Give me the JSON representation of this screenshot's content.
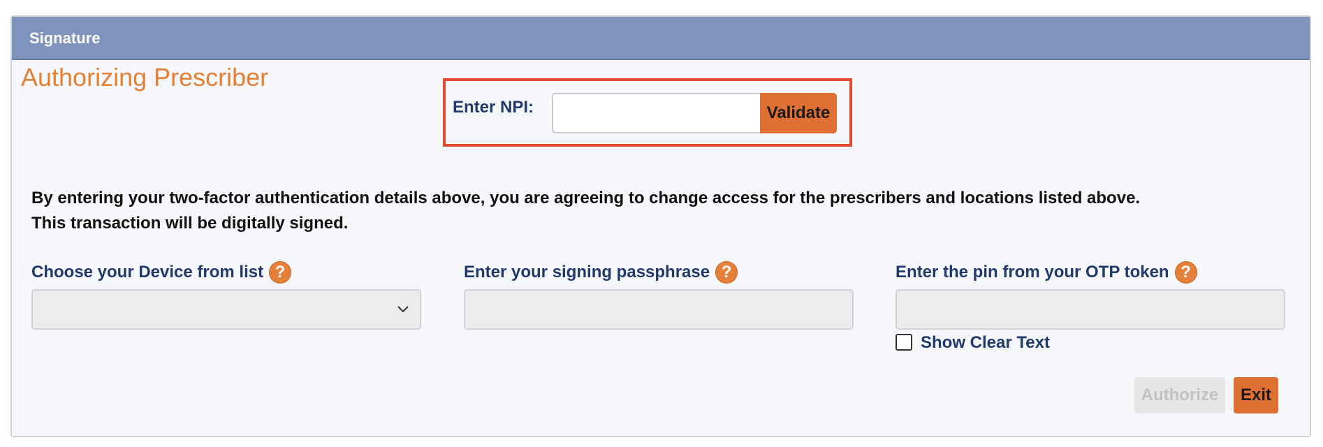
{
  "panel": {
    "title": "Signature"
  },
  "section": {
    "title": "Authorizing Prescriber"
  },
  "npi": {
    "label": "Enter NPI:",
    "value": "",
    "validate_label": "Validate"
  },
  "agreement": {
    "line1": "By entering your two-factor authentication details above, you are agreeing to change access for the prescribers and locations listed above.",
    "line2": "This transaction will be digitally signed."
  },
  "fields": {
    "device": {
      "label": "Choose your Device from list",
      "selected": ""
    },
    "passphrase": {
      "label": "Enter your signing passphrase",
      "value": ""
    },
    "otp": {
      "label": "Enter the pin from your OTP token",
      "value": ""
    },
    "help_glyph": "?"
  },
  "show_clear_text": {
    "label": "Show Clear Text",
    "checked": false
  },
  "actions": {
    "authorize_label": "Authorize",
    "exit_label": "Exit"
  },
  "colors": {
    "header": "#7f94bc",
    "accent_orange": "#e06f34",
    "title_orange": "#e47f34",
    "label_navy": "#223a6b",
    "highlight_red": "#e24a33"
  }
}
